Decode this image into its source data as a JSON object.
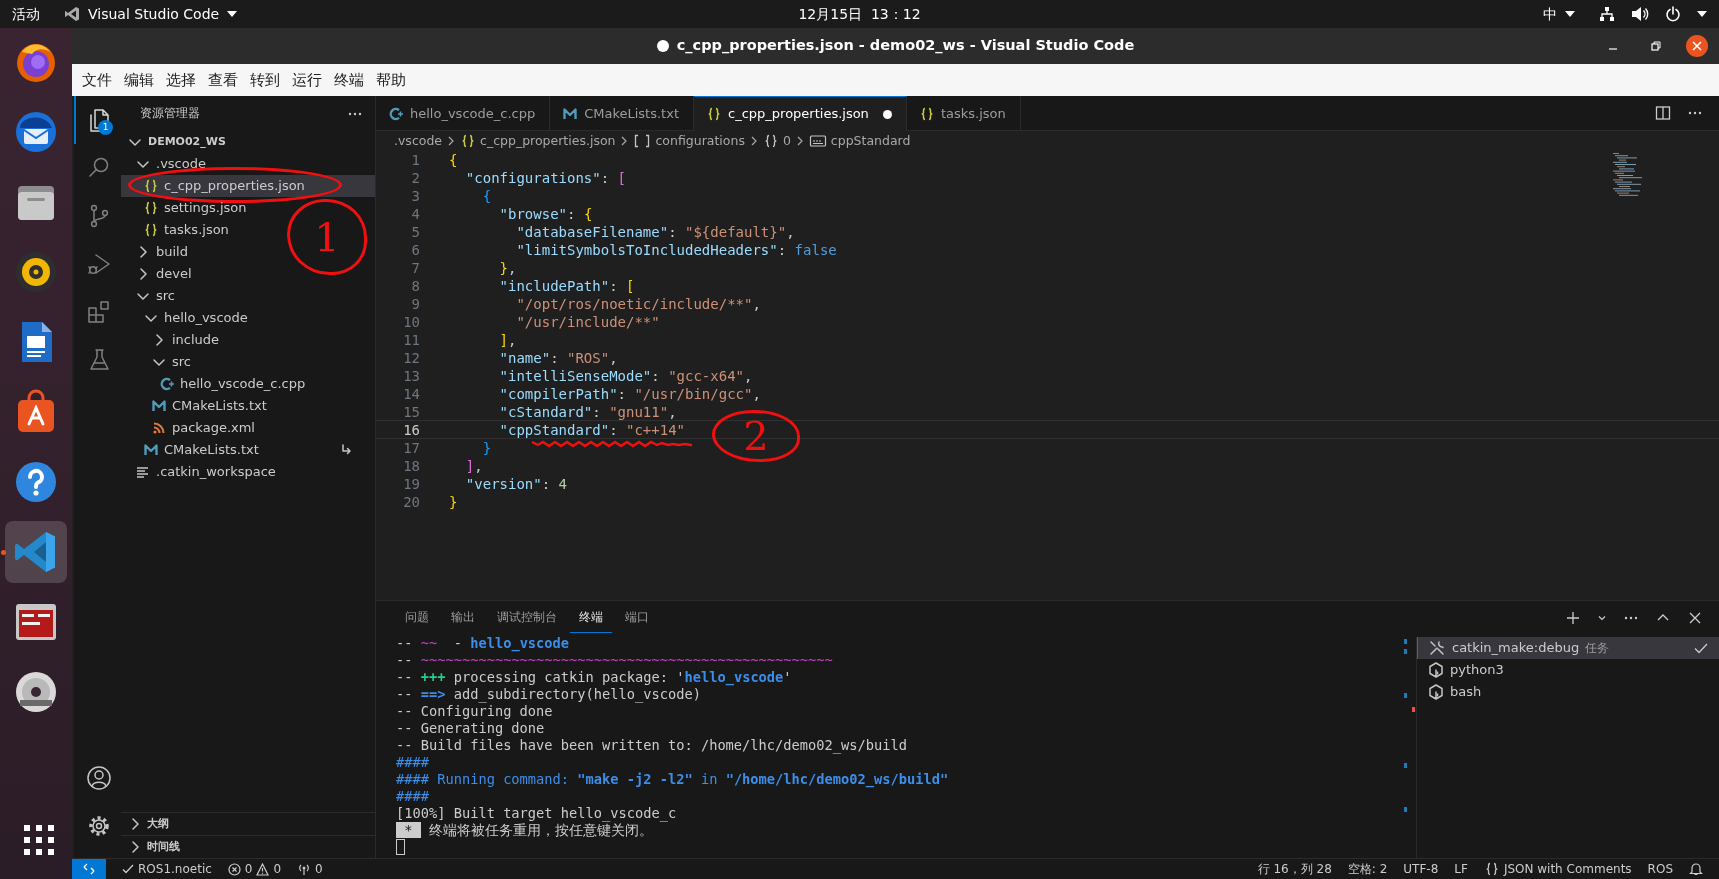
{
  "top_bar": {
    "activities": "活动",
    "app_menu": "Visual Studio Code",
    "clock": "12月15日  13：12",
    "input_method": "中"
  },
  "dock": [
    {
      "kind": "browser",
      "selected": false,
      "running": false
    },
    {
      "kind": "mail",
      "selected": false,
      "running": false
    },
    {
      "kind": "files",
      "selected": false,
      "running": false
    },
    {
      "kind": "music",
      "selected": false,
      "running": false
    },
    {
      "kind": "writer",
      "selected": false,
      "running": false
    },
    {
      "kind": "store",
      "selected": false,
      "running": false
    },
    {
      "kind": "help",
      "selected": false,
      "running": false
    },
    {
      "kind": "code",
      "selected": true,
      "running": true
    },
    {
      "kind": "terminal",
      "selected": false,
      "running": false
    },
    {
      "kind": "disc",
      "selected": false,
      "running": false
    }
  ],
  "window": {
    "title": "c_cpp_properties.json - demo02_ws - Visual Studio Code",
    "modified": true
  },
  "menu": [
    "文件",
    "编辑",
    "选择",
    "查看",
    "转到",
    "运行",
    "终端",
    "帮助"
  ],
  "activity_bar": [
    {
      "kind": "explorer",
      "selected": true,
      "badge": "1"
    },
    {
      "kind": "search",
      "selected": false
    },
    {
      "kind": "scm",
      "selected": false
    },
    {
      "kind": "debug",
      "selected": false
    },
    {
      "kind": "extensions",
      "selected": false
    },
    {
      "kind": "testing",
      "selected": false
    }
  ],
  "sidebar": {
    "title": "资源管理器",
    "tree": [
      {
        "label": "DEMO02_WS",
        "kind": "folder",
        "expanded": true,
        "selected": false,
        "children": [
          {
            "label": ".vscode",
            "kind": "folder",
            "expanded": true,
            "selected": false,
            "children": [
              {
                "label": "c_cpp_properties.json",
                "kind": "json",
                "selected": true,
                "annotation": "1"
              },
              {
                "label": "settings.json",
                "kind": "json",
                "selected": false
              },
              {
                "label": "tasks.json",
                "kind": "json",
                "selected": false
              }
            ]
          },
          {
            "label": "build",
            "kind": "folder",
            "expanded": false,
            "selected": false
          },
          {
            "label": "devel",
            "kind": "folder",
            "expanded": false,
            "selected": false
          },
          {
            "label": "src",
            "kind": "folder",
            "expanded": true,
            "selected": false,
            "children": [
              {
                "label": "hello_vscode",
                "kind": "folder",
                "expanded": true,
                "selected": false,
                "children": [
                  {
                    "label": "include",
                    "kind": "folder",
                    "expanded": false,
                    "selected": false
                  },
                  {
                    "label": "src",
                    "kind": "folder",
                    "expanded": true,
                    "selected": false,
                    "children": [
                      {
                        "label": "hello_vscode_c.cpp",
                        "kind": "cpp",
                        "selected": false
                      }
                    ]
                  },
                  {
                    "label": "CMakeLists.txt",
                    "kind": "cmake",
                    "selected": false
                  },
                  {
                    "label": "package.xml",
                    "kind": "xml",
                    "selected": false
                  }
                ]
              },
              {
                "label": "CMakeLists.txt",
                "kind": "cmake",
                "selected": false,
                "linked": true
              }
            ]
          },
          {
            "label": ".catkin_workspace",
            "kind": "text",
            "selected": false
          }
        ]
      }
    ],
    "sections": [
      {
        "label": "大纲",
        "expanded": false
      },
      {
        "label": "时间线",
        "expanded": false
      }
    ]
  },
  "editor": {
    "tabs": [
      {
        "label": "hello_vscode_c.cpp",
        "kind": "cpp",
        "selected": false,
        "modified": false
      },
      {
        "label": "CMakeLists.txt",
        "kind": "cmake",
        "selected": false,
        "modified": false
      },
      {
        "label": "c_cpp_properties.json",
        "kind": "json",
        "selected": true,
        "modified": true
      },
      {
        "label": "tasks.json",
        "kind": "json",
        "selected": false,
        "modified": false
      }
    ],
    "breadcrumb": [
      {
        "kind": "folder",
        "label": ".vscode"
      },
      {
        "kind": "json",
        "label": "c_cpp_properties.json"
      },
      {
        "kind": "array",
        "label": "configurations"
      },
      {
        "kind": "object",
        "label": "0"
      },
      {
        "kind": "string",
        "label": "cppStandard"
      }
    ],
    "lines": [
      {
        "number": "1",
        "current": false,
        "tokens": [
          {
            "kind": "brace1",
            "text": "{"
          }
        ]
      },
      {
        "number": "2",
        "current": false,
        "tokens": [
          {
            "kind": "key",
            "text": "  \"configurations\""
          },
          {
            "kind": "punct",
            "text": ": "
          },
          {
            "kind": "brace2",
            "text": "["
          }
        ]
      },
      {
        "number": "3",
        "current": false,
        "tokens": [
          {
            "kind": "brace3",
            "text": "    {"
          }
        ]
      },
      {
        "number": "4",
        "current": false,
        "tokens": [
          {
            "kind": "key",
            "text": "      \"browse\""
          },
          {
            "kind": "punct",
            "text": ": "
          },
          {
            "kind": "brace1",
            "text": "{"
          }
        ]
      },
      {
        "number": "5",
        "current": false,
        "tokens": [
          {
            "kind": "key",
            "text": "        \"databaseFilename\""
          },
          {
            "kind": "punct",
            "text": ": "
          },
          {
            "kind": "string",
            "text": "\"${default}\""
          },
          {
            "kind": "punct",
            "text": ","
          }
        ]
      },
      {
        "number": "6",
        "current": false,
        "tokens": [
          {
            "kind": "key",
            "text": "        \"limitSymbolsToIncludedHeaders\""
          },
          {
            "kind": "punct",
            "text": ": "
          },
          {
            "kind": "bool",
            "text": "false"
          }
        ]
      },
      {
        "number": "7",
        "current": false,
        "tokens": [
          {
            "kind": "brace1",
            "text": "      }"
          },
          {
            "kind": "punct",
            "text": ","
          }
        ]
      },
      {
        "number": "8",
        "current": false,
        "tokens": [
          {
            "kind": "key",
            "text": "      \"includePath\""
          },
          {
            "kind": "punct",
            "text": ": "
          },
          {
            "kind": "brace1",
            "text": "["
          }
        ]
      },
      {
        "number": "9",
        "current": false,
        "tokens": [
          {
            "kind": "string",
            "text": "        \"/opt/ros/noetic/include/**\""
          },
          {
            "kind": "punct",
            "text": ","
          }
        ]
      },
      {
        "number": "10",
        "current": false,
        "tokens": [
          {
            "kind": "string",
            "text": "        \"/usr/include/**\""
          }
        ]
      },
      {
        "number": "11",
        "current": false,
        "tokens": [
          {
            "kind": "brace1",
            "text": "      ]"
          },
          {
            "kind": "punct",
            "text": ","
          }
        ]
      },
      {
        "number": "12",
        "current": false,
        "tokens": [
          {
            "kind": "key",
            "text": "      \"name\""
          },
          {
            "kind": "punct",
            "text": ": "
          },
          {
            "kind": "string",
            "text": "\"ROS\""
          },
          {
            "kind": "punct",
            "text": ","
          }
        ]
      },
      {
        "number": "13",
        "current": false,
        "tokens": [
          {
            "kind": "key",
            "text": "      \"intelliSenseMode\""
          },
          {
            "kind": "punct",
            "text": ": "
          },
          {
            "kind": "string",
            "text": "\"gcc-x64\""
          },
          {
            "kind": "punct",
            "text": ","
          }
        ]
      },
      {
        "number": "14",
        "current": false,
        "tokens": [
          {
            "kind": "key",
            "text": "      \"compilerPath\""
          },
          {
            "kind": "punct",
            "text": ": "
          },
          {
            "kind": "string",
            "text": "\"/usr/bin/gcc\""
          },
          {
            "kind": "punct",
            "text": ","
          }
        ]
      },
      {
        "number": "15",
        "current": false,
        "tokens": [
          {
            "kind": "key",
            "text": "      \"cStandard\""
          },
          {
            "kind": "punct",
            "text": ": "
          },
          {
            "kind": "string",
            "text": "\"gnu11\""
          },
          {
            "kind": "punct",
            "text": ","
          }
        ]
      },
      {
        "number": "16",
        "current": true,
        "annotation": "2",
        "tokens": [
          {
            "kind": "key",
            "text": "      \"cppStandard\""
          },
          {
            "kind": "punct",
            "text": ": "
          },
          {
            "kind": "string",
            "text": "\"c++14\""
          }
        ]
      },
      {
        "number": "17",
        "current": false,
        "tokens": [
          {
            "kind": "brace3",
            "text": "    }"
          }
        ]
      },
      {
        "number": "18",
        "current": false,
        "tokens": [
          {
            "kind": "brace2",
            "text": "  ]"
          },
          {
            "kind": "punct",
            "text": ","
          }
        ]
      },
      {
        "number": "19",
        "current": false,
        "tokens": [
          {
            "kind": "key",
            "text": "  \"version\""
          },
          {
            "kind": "punct",
            "text": ": "
          },
          {
            "kind": "number",
            "text": "4"
          }
        ]
      },
      {
        "number": "20",
        "current": false,
        "tokens": [
          {
            "kind": "brace1",
            "text": "}"
          }
        ]
      }
    ]
  },
  "panel": {
    "tabs": [
      {
        "label": "问题",
        "selected": false
      },
      {
        "label": "输出",
        "selected": false
      },
      {
        "label": "调试控制台",
        "selected": false
      },
      {
        "label": "终端",
        "selected": true
      },
      {
        "label": "端口",
        "selected": false
      }
    ],
    "terminal_lines": [
      {
        "tokens": [
          {
            "kind": "plain",
            "text": "-- "
          },
          {
            "kind": "magenta",
            "text": "~~"
          },
          {
            "kind": "plain",
            "text": "  - "
          },
          {
            "kind": "bluebold",
            "text": "hello_vscode"
          }
        ]
      },
      {
        "tokens": [
          {
            "kind": "plain",
            "text": "-- "
          },
          {
            "kind": "magenta",
            "text": "~~~~~~~~~~~~~~~~~~~~~~~~~~~~~~~~~~~~~~~~~~~~~~~~~~"
          }
        ]
      },
      {
        "tokens": [
          {
            "kind": "plain",
            "text": "-- "
          },
          {
            "kind": "greenbold",
            "text": "+++"
          },
          {
            "kind": "plain",
            "text": " processing catkin package: '"
          },
          {
            "kind": "bluebold",
            "text": "hello_vscode"
          },
          {
            "kind": "plain",
            "text": "'"
          }
        ]
      },
      {
        "tokens": [
          {
            "kind": "plain",
            "text": "-- "
          },
          {
            "kind": "bluebold",
            "text": "==>"
          },
          {
            "kind": "plain",
            "text": " add_subdirectory(hello_vscode)"
          }
        ]
      },
      {
        "tokens": [
          {
            "kind": "plain",
            "text": "-- Configuring done"
          }
        ]
      },
      {
        "tokens": [
          {
            "kind": "plain",
            "text": "-- Generating done"
          }
        ]
      },
      {
        "tokens": [
          {
            "kind": "plain",
            "text": "-- Build files have been written to: /home/lhc/demo02_ws/build"
          }
        ]
      },
      {
        "tokens": [
          {
            "kind": "blue",
            "text": "####"
          }
        ]
      },
      {
        "tokens": [
          {
            "kind": "blue",
            "text": "#### Running command: "
          },
          {
            "kind": "bluebold",
            "text": "\"make -j2 -l2\""
          },
          {
            "kind": "blue",
            "text": " in "
          },
          {
            "kind": "bluebold",
            "text": "\"/home/lhc/demo02_ws/build\""
          }
        ]
      },
      {
        "tokens": [
          {
            "kind": "blue",
            "text": "####"
          }
        ]
      },
      {
        "tokens": [
          {
            "kind": "plain",
            "text": "[100%] Built target hello_vscode_c"
          }
        ]
      },
      {
        "tokens": [
          {
            "kind": "inverse",
            "text": " * "
          },
          {
            "kind": "plain",
            "text": " 终端将被任务重用，按任意键关闭。"
          }
        ]
      }
    ],
    "terminals": [
      {
        "kind": "task",
        "name": "catkin_make:debug",
        "detail": "任务",
        "selected": true
      },
      {
        "kind": "shell",
        "name": "python3",
        "selected": false
      },
      {
        "kind": "shell",
        "name": "bash",
        "selected": false
      }
    ]
  },
  "status_bar": {
    "left": [
      {
        "kind": "profile",
        "text": "ROS1.noetic"
      },
      {
        "kind": "problems",
        "errors": "0",
        "warnings": "0"
      },
      {
        "kind": "ports",
        "text": "0"
      }
    ],
    "right": [
      {
        "kind": "text",
        "text": "行 16，列 28"
      },
      {
        "kind": "text",
        "text": "空格: 2"
      },
      {
        "kind": "text",
        "text": "UTF-8"
      },
      {
        "kind": "text",
        "text": "LF"
      },
      {
        "kind": "language",
        "text": "JSON with Comments"
      },
      {
        "kind": "text",
        "text": "ROS"
      },
      {
        "kind": "bell"
      }
    ]
  }
}
